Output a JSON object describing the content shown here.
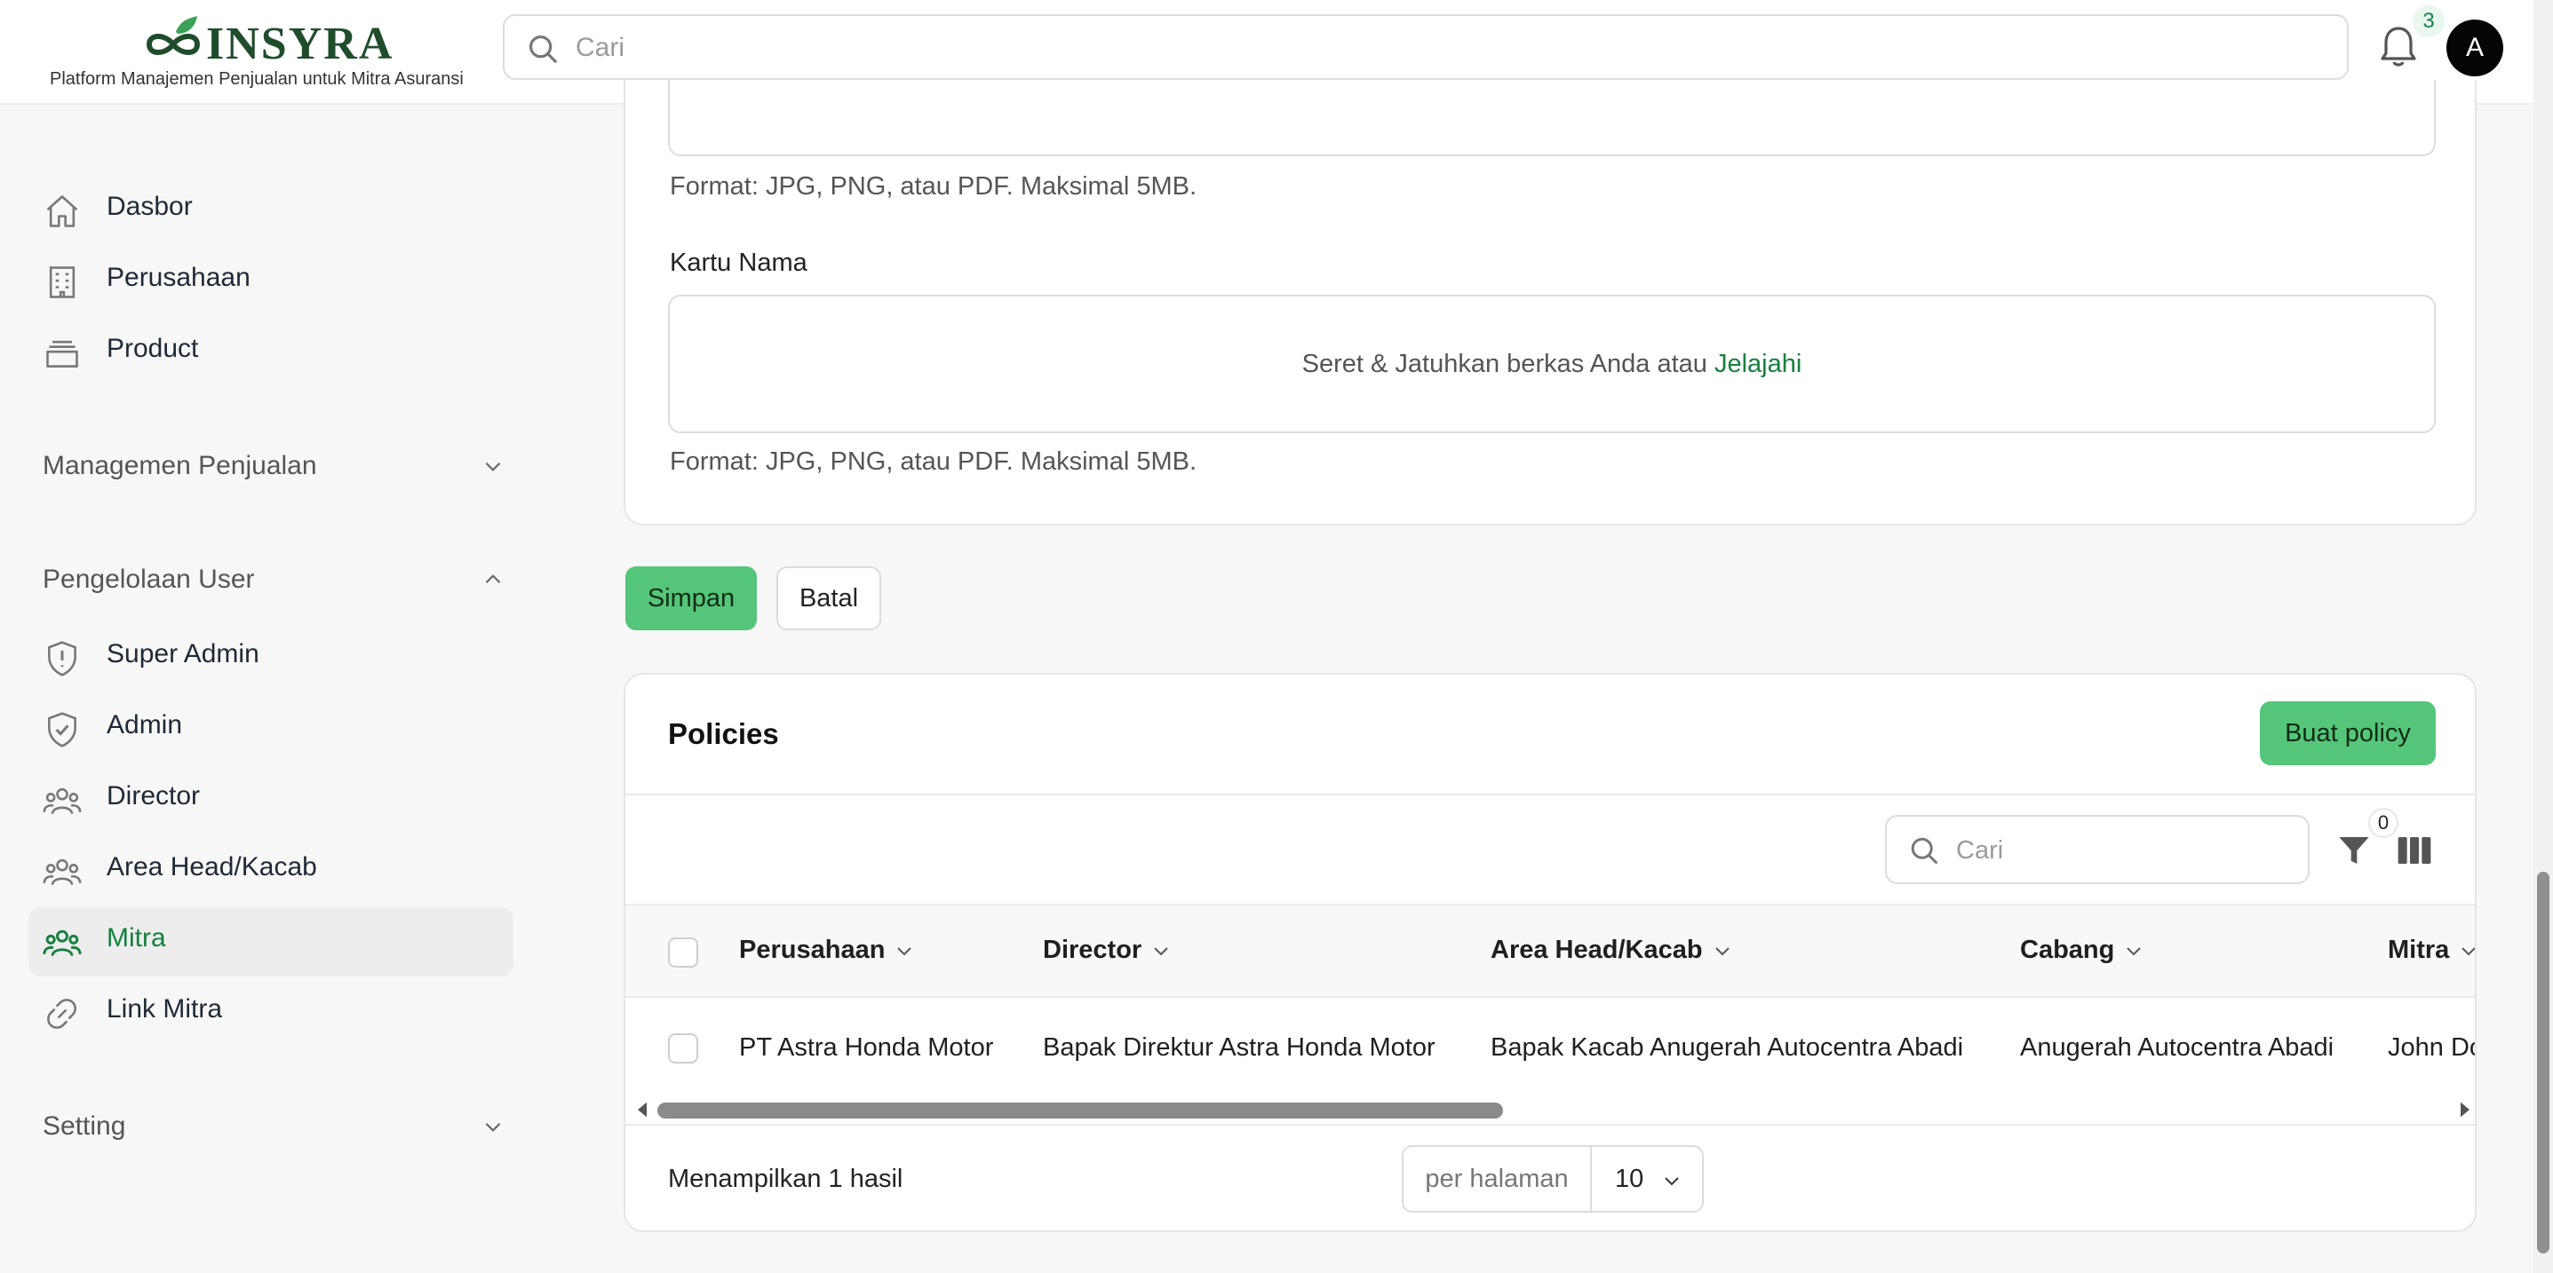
{
  "brand": {
    "name": "INSYRA",
    "tagline": "Platform Manajemen Penjualan untuk Mitra Asuransi"
  },
  "header": {
    "search_placeholder": "Cari",
    "notification_count": "3",
    "avatar_initial": "A"
  },
  "sidebar": {
    "items_top": [
      {
        "label": "Dasbor",
        "icon": "home-icon"
      },
      {
        "label": "Perusahaan",
        "icon": "building-icon"
      },
      {
        "label": "Product",
        "icon": "box-icon"
      }
    ],
    "sections": [
      {
        "label": "Managemen Penjualan",
        "expanded": false
      },
      {
        "label": "Pengelolaan User",
        "expanded": true
      },
      {
        "label": "Setting",
        "expanded": false
      }
    ],
    "user_items": [
      {
        "label": "Super Admin",
        "icon": "shield-alert-icon"
      },
      {
        "label": "Admin",
        "icon": "shield-check-icon"
      },
      {
        "label": "Director",
        "icon": "users-icon"
      },
      {
        "label": "Area Head/Kacab",
        "icon": "users-icon"
      },
      {
        "label": "Mitra",
        "icon": "users-icon",
        "active": true
      },
      {
        "label": "Link Mitra",
        "icon": "link-icon"
      }
    ]
  },
  "form": {
    "format_hint": "Format: JPG, PNG, atau PDF. Maksimal 5MB.",
    "business_card_label": "Kartu Nama",
    "dropzone_text": "Seret & Jatuhkan berkas Anda atau",
    "browse_label": "Jelajahi",
    "save_label": "Simpan",
    "cancel_label": "Batal"
  },
  "policies": {
    "title": "Policies",
    "create_label": "Buat policy",
    "search_placeholder": "Cari",
    "filter_count": "0",
    "columns": [
      "Perusahaan",
      "Director",
      "Area Head/Kacab",
      "Cabang",
      "Mitra"
    ],
    "rows": [
      [
        "PT Astra Honda Motor",
        "Bapak Direktur Astra Honda Motor",
        "Bapak Kacab Anugerah Autocentra Abadi",
        "Anugerah Autocentra Abadi",
        "John Do"
      ]
    ],
    "result_text": "Menampilkan 1 hasil",
    "per_page_label": "per halaman",
    "per_page_value": "10"
  },
  "colors": {
    "accent": "#55c57a",
    "accent_text": "#15803d",
    "brand": "#1f4d2b"
  }
}
